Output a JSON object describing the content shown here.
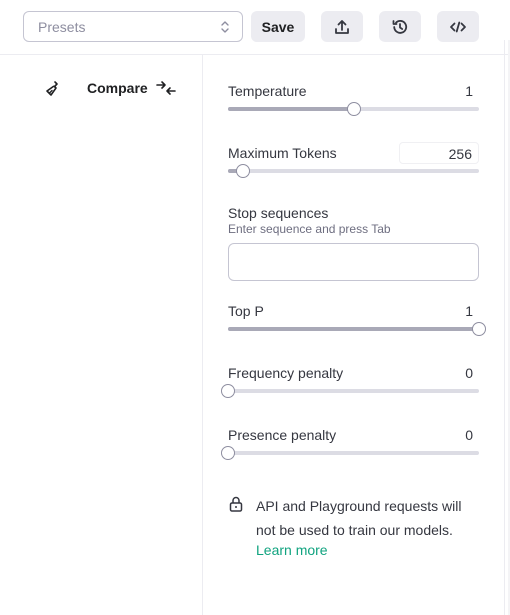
{
  "toolbar": {
    "presets_placeholder": "Presets",
    "save_label": "Save"
  },
  "left_pane": {
    "compare_label": "Compare"
  },
  "parameters": {
    "temperature": {
      "label": "Temperature",
      "value": "1",
      "fraction": 0.5
    },
    "max_tokens": {
      "label": "Maximum Tokens",
      "value": "256",
      "fraction": 0.06
    },
    "top_p": {
      "label": "Top P",
      "value": "1",
      "fraction": 1.0
    },
    "frequency_penalty": {
      "label": "Frequency penalty",
      "value": "0",
      "fraction": 0.0
    },
    "presence_penalty": {
      "label": "Presence penalty",
      "value": "0",
      "fraction": 0.0
    }
  },
  "stop_sequences": {
    "label": "Stop sequences",
    "hint": "Enter sequence and press Tab",
    "value": ""
  },
  "notice": {
    "text": "API and Playground requests will not be used to train our models.",
    "link": "Learn more"
  },
  "colors": {
    "accent": "#10a37f",
    "button_bg": "#ececf1",
    "slider_fill": "#a9a9b7",
    "slider_track": "#dcdce4"
  },
  "icons": [
    "chevron-updown-icon",
    "upload-icon",
    "history-icon",
    "code-icon",
    "broom-icon",
    "compare-arrows-icon",
    "lock-icon"
  ]
}
